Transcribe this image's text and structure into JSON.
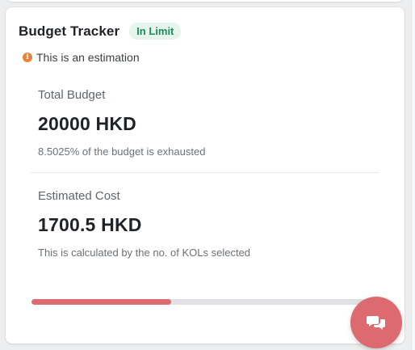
{
  "budget_tracker": {
    "title": "Budget Tracker",
    "status_badge": "In Limit",
    "note": "This is an estimation",
    "note_icon": "info-icon",
    "total_budget": {
      "label": "Total Budget",
      "value": "20000 HKD",
      "description": "8.5025% of the budget is exhausted"
    },
    "estimated_cost": {
      "label": "Estimated Cost",
      "value": "1700.5 HKD",
      "description": "This is calculated by the no. of KOLs selected"
    },
    "progress": {
      "fraction": 0.4
    }
  },
  "chat_button": {
    "icon": "chat-bubbles-icon"
  },
  "colors": {
    "accent": "#dc6a6e",
    "badge_bg": "#e6f4ee",
    "badge_text": "#1f8a5b",
    "info_icon": "#e9823a",
    "progress_track": "#dfe1e4"
  }
}
